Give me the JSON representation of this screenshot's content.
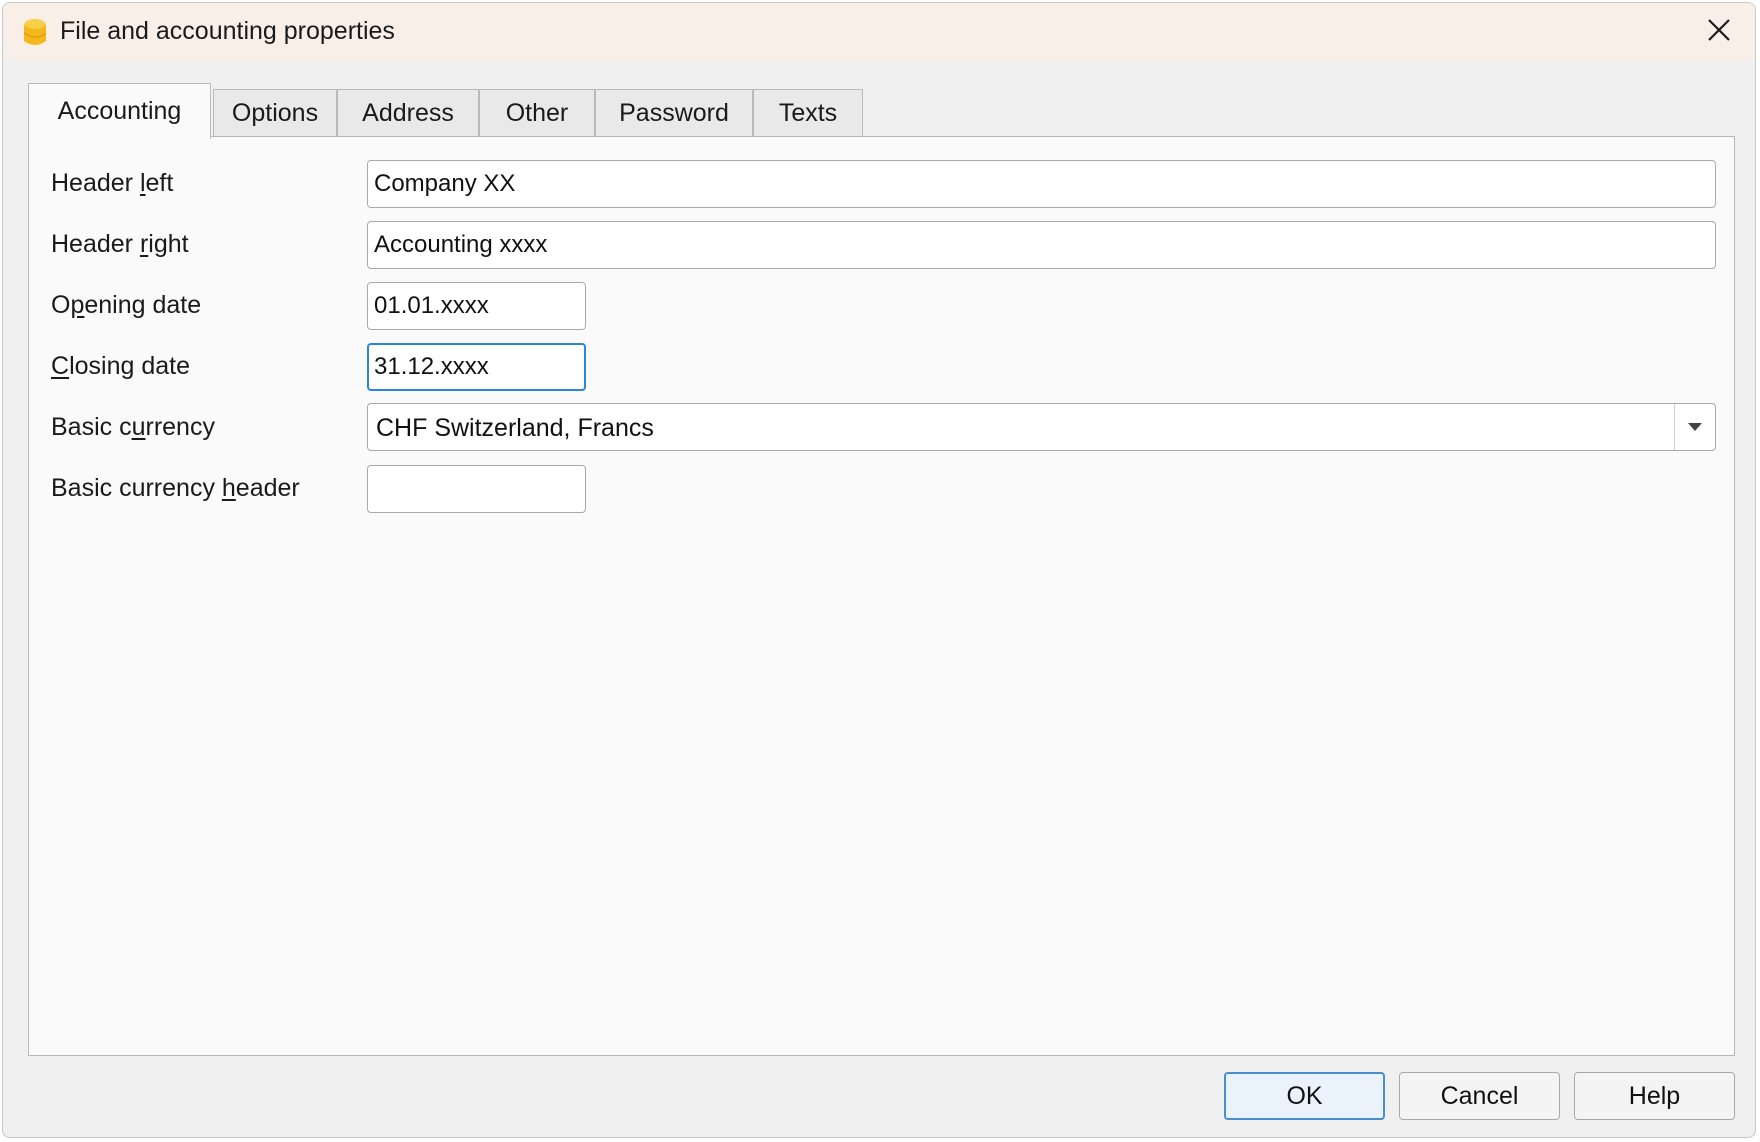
{
  "window": {
    "title": "File and accounting properties",
    "app_icon": "banana-accounting-icon",
    "close_icon": "close-icon"
  },
  "tabs": [
    {
      "label": "Accounting",
      "active": true
    },
    {
      "label": "Options",
      "active": false
    },
    {
      "label": "Address",
      "active": false
    },
    {
      "label": "Other",
      "active": false
    },
    {
      "label": "Password",
      "active": false
    },
    {
      "label": "Texts",
      "active": false
    }
  ],
  "form": {
    "header_left": {
      "label_pre": "Header ",
      "label_u": "l",
      "label_post": "eft",
      "value": "Company XX"
    },
    "header_right": {
      "label_pre": "Header ",
      "label_u": "r",
      "label_post": "ight",
      "value": "Accounting xxxx"
    },
    "opening_date": {
      "label_pre": "O",
      "label_u": "p",
      "label_post": "ening date",
      "value": "01.01.xxxx"
    },
    "closing_date": {
      "label_pre": "",
      "label_u": "C",
      "label_post": "losing date",
      "value": "31.12.xxxx"
    },
    "basic_currency": {
      "label_pre": "Basic c",
      "label_u": "u",
      "label_post": "rrency",
      "value": "CHF Switzerland, Francs"
    },
    "basic_currency_header": {
      "label_pre": "Basic currency ",
      "label_u": "h",
      "label_post": "eader",
      "value": ""
    }
  },
  "buttons": {
    "ok": "OK",
    "cancel": "Cancel",
    "help": "Help"
  },
  "colors": {
    "titlebar": "#f8efe9",
    "focus": "#2a86d6",
    "icon": "#f5b81c"
  }
}
